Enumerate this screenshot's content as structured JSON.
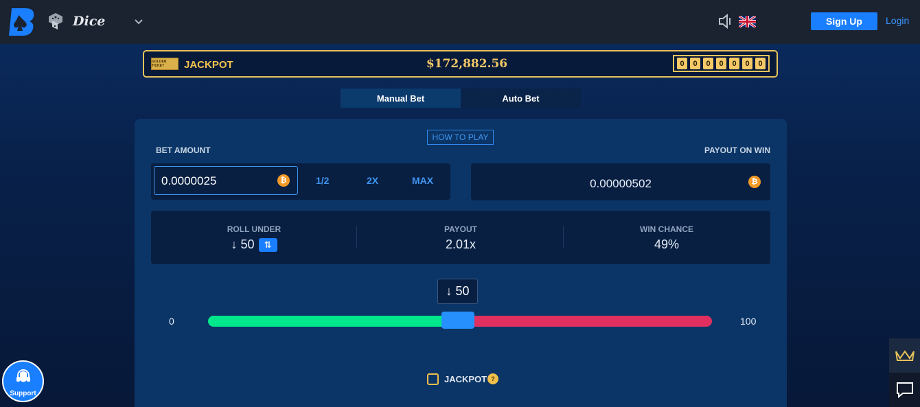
{
  "header": {
    "game_name": "Dice",
    "signup_label": "Sign Up",
    "login_label": "Login",
    "icons": [
      "brand-logo-icon",
      "dice-icon",
      "chevron-down-icon",
      "speaker-icon",
      "uk-flag-icon"
    ]
  },
  "jackpot": {
    "ticket_label": "GOLDEN TICKET",
    "label": "JACKPOT",
    "amount": "$172,882.56",
    "digits": [
      "0",
      "0",
      "0",
      "0",
      "0",
      "0",
      "0"
    ]
  },
  "tabs": [
    {
      "label": "Manual Bet",
      "active": true
    },
    {
      "label": "Auto Bet",
      "active": false
    }
  ],
  "how_to_play": "HOW TO PLAY",
  "bet": {
    "label": "BET AMOUNT",
    "value": "0.0000025",
    "half_label": "1/2",
    "double_label": "2X",
    "max_label": "MAX",
    "currency_symbol": "₿"
  },
  "payout_on_win": {
    "label": "PAYOUT ON WIN",
    "value": "0.00000502",
    "currency_symbol": "₿"
  },
  "stats": {
    "roll_under_label": "ROLL UNDER",
    "roll_under_value": "↓ 50",
    "swap_icon": "⇅",
    "payout_label": "PAYOUT",
    "payout_value": "2.01x",
    "win_chance_label": "WIN CHANCE",
    "win_chance_value": "49%"
  },
  "slider": {
    "bubble": "↓ 50",
    "min": "0",
    "max": "100",
    "value": 50,
    "win_color": "#00e88b",
    "lose_color": "#e1305f"
  },
  "jackpot_checkbox": {
    "label": "JACKPOT",
    "help": "?",
    "checked": false
  },
  "support": {
    "label": "Support"
  },
  "side_widgets": [
    "crown-icon",
    "chat-icon"
  ],
  "colors": {
    "accent": "#1a7fff",
    "gold": "#f0c04b",
    "bitcoin": "#f39a26"
  }
}
